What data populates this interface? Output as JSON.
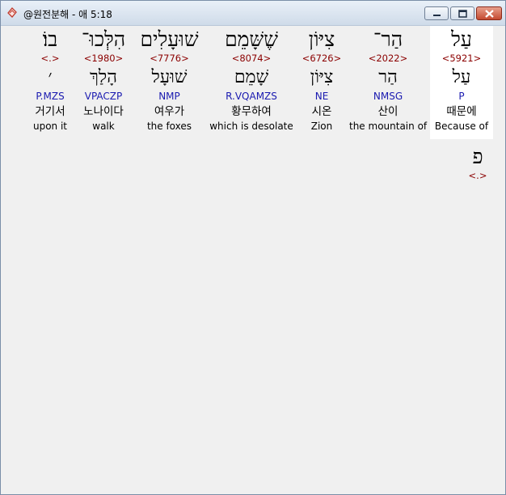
{
  "window": {
    "title": "@원전분해 - 애 5:18",
    "app_icon": "bible-book-icon",
    "controls": [
      "minimize-icon",
      "maximize-icon",
      "close-icon"
    ]
  },
  "words": [
    {
      "hebrew": "עַל",
      "strong": "<5921>",
      "hebrew_lemma": "עַל",
      "morph": "P",
      "korean": "때문에",
      "english": "Because of"
    },
    {
      "hebrew": "הַר־",
      "strong": "<2022>",
      "hebrew_lemma": "הַר",
      "morph": "NMSG",
      "korean": "산이",
      "english": "the mountain of"
    },
    {
      "hebrew": "צִיּוֹן",
      "strong": "<6726>",
      "hebrew_lemma": "צִיּוֹן",
      "morph": "NE",
      "korean": "시온",
      "english": "Zion"
    },
    {
      "hebrew": "שֶׁשָּׁמֵם",
      "strong": "<8074>",
      "hebrew_lemma": "שָׁמֵם",
      "morph": "R.VQAMZS",
      "korean": "황무하여",
      "english": "which is desolate"
    },
    {
      "hebrew": "שׁוּעָלִים",
      "strong": "<7776>",
      "hebrew_lemma": "שׁוּעָל",
      "morph": "NMP",
      "korean": "여우가",
      "english": "the foxes"
    },
    {
      "hebrew": "הִלְּכוּ־",
      "strong": "<1980>",
      "hebrew_lemma": "הָלַךְ",
      "morph": "VPACZP",
      "korean": "노나이다",
      "english": "walk"
    },
    {
      "hebrew": "בוֹ׃",
      "strong": "<.>",
      "hebrew_lemma": "׳",
      "morph": "P.MZS",
      "korean": "거기서",
      "english": "upon it"
    }
  ],
  "trailing": {
    "hebrew": "פ",
    "strong": "<.>"
  }
}
